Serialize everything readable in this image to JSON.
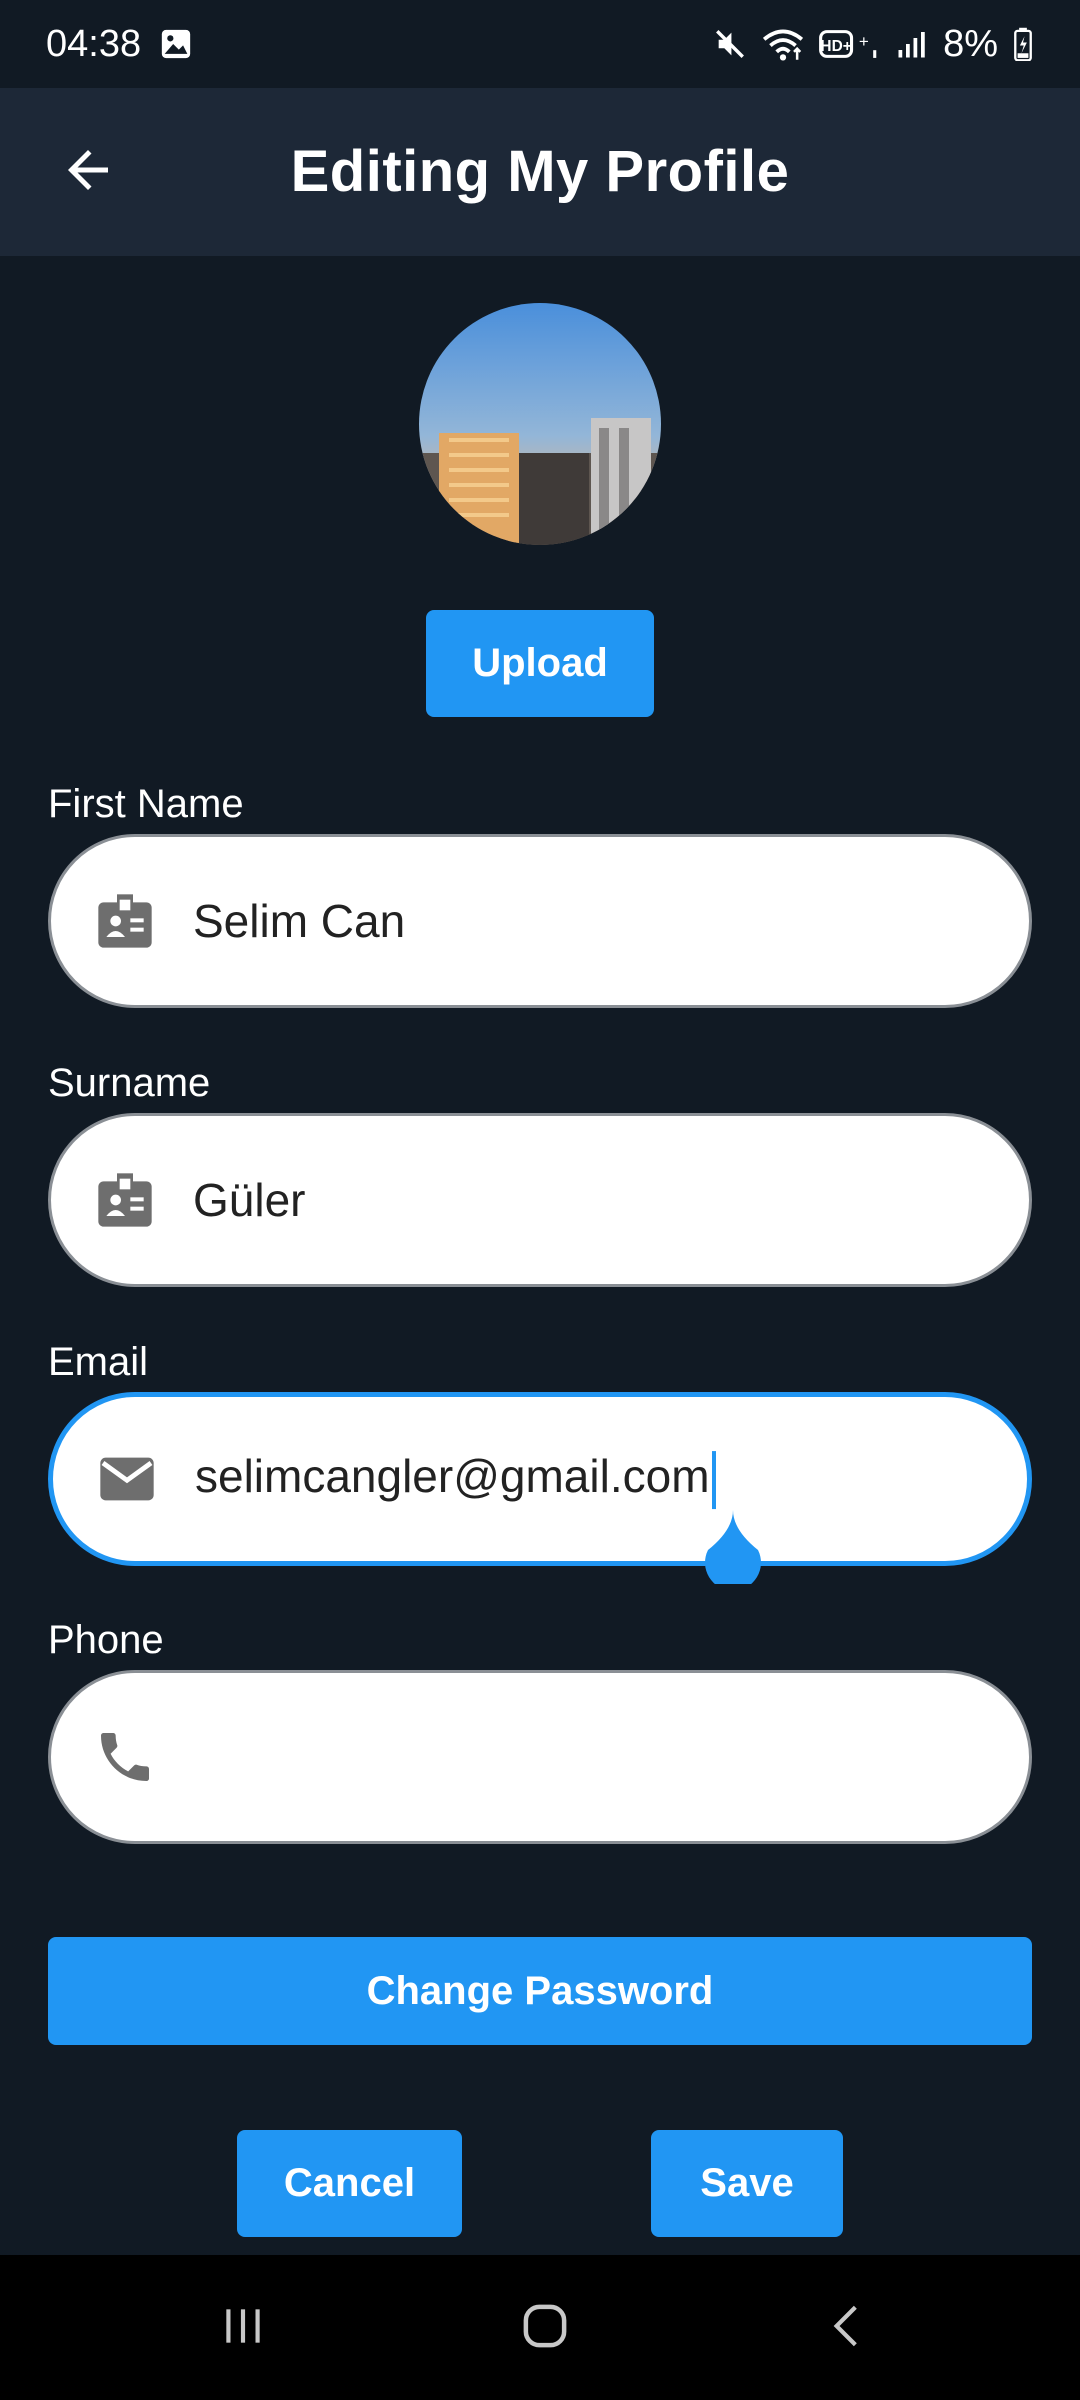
{
  "status_bar": {
    "time": "04:38",
    "battery": "8%",
    "network_label": "HD+",
    "icons": [
      "gallery-icon",
      "mute-icon",
      "wifi-icon",
      "volte-icon",
      "signal-icon",
      "battery-charging-icon"
    ]
  },
  "app_bar": {
    "title": "Editing My Profile",
    "back_icon": "arrow-back-icon"
  },
  "profile": {
    "upload_label": "Upload"
  },
  "form": {
    "first_name": {
      "label": "First Name",
      "value": "Selim Can",
      "icon": "badge-icon"
    },
    "surname": {
      "label": "Surname",
      "value": "Güler",
      "icon": "badge-icon"
    },
    "email": {
      "label": "Email",
      "value": "selimcangler@gmail.com",
      "icon": "mail-icon",
      "focused": true
    },
    "phone": {
      "label": "Phone",
      "value": "",
      "icon": "phone-icon"
    }
  },
  "actions": {
    "change_password": "Change Password",
    "cancel": "Cancel",
    "save": "Save"
  },
  "nav_bar": {
    "icons": [
      "recents-icon",
      "home-icon",
      "back-icon"
    ]
  },
  "colors": {
    "background": "#111a24",
    "app_bar": "#1d2837",
    "accent": "#2196f3",
    "field_bg": "#ffffff",
    "icon_gray": "#6e6e6e"
  }
}
